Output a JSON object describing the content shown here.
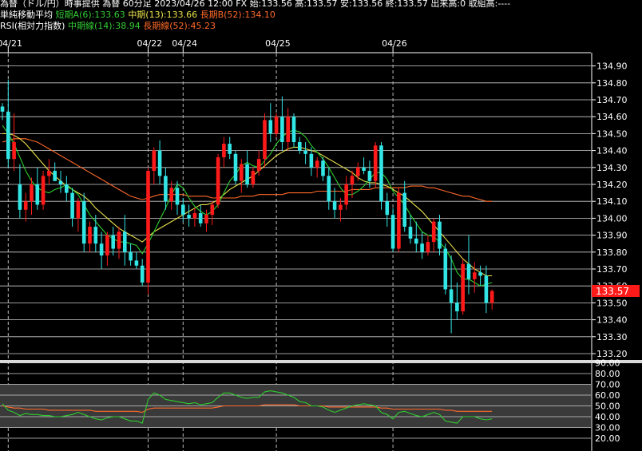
{
  "header": {
    "line1": "為替（ドル/円）時事提供 為替 60分足 2023/04/26 12:00 FX 始:133.56 高:133.57 安:133.56 終:133.57 出来高:0 取組高:----",
    "ma_title": "単純移動平均",
    "ma_short": "短期A(6):133.63",
    "ma_mid": "中期(13):133.66",
    "ma_long": "長期B(52):134.10",
    "rsi_title": "RSI(相対力指数)",
    "rsi_short": "中期線(14):38.94",
    "rsi_long": "長期線(52):45.23"
  },
  "colors": {
    "background": "#000000",
    "up": "#ff1a1a",
    "down": "#33e6e6",
    "ma_short": "#2ecc2e",
    "ma_mid": "#e8e04a",
    "ma_long": "#ff6a2a",
    "rsi_short": "#2ecc2e",
    "rsi_long": "#ff6a2a",
    "grid": "#ffffff",
    "badge": "#ff1a1a"
  },
  "chart_data": {
    "type": "candlestick",
    "dates": [
      {
        "label": "04/21",
        "index": 1
      },
      {
        "label": "04/22",
        "index": 25
      },
      {
        "label": "04/24",
        "index": 31
      },
      {
        "label": "04/25",
        "index": 47
      },
      {
        "label": "04/26",
        "index": 67
      }
    ],
    "ylim": [
      133.2,
      134.95
    ],
    "yticks": [
      "134.90",
      "134.80",
      "134.70",
      "134.60",
      "134.50",
      "134.40",
      "134.30",
      "134.20",
      "134.10",
      "134.00",
      "133.90",
      "133.80",
      "133.70",
      "133.60",
      "133.50",
      "133.40",
      "133.30",
      "133.20"
    ],
    "last_price": "133.57",
    "candles": [
      [
        134.66,
        134.68,
        134.58,
        134.63
      ],
      [
        134.63,
        134.82,
        134.3,
        134.35
      ],
      [
        134.35,
        134.62,
        134.28,
        134.45
      ],
      [
        134.2,
        134.32,
        134.0,
        134.05
      ],
      [
        134.05,
        134.15,
        133.98,
        134.1
      ],
      [
        134.1,
        134.24,
        134.02,
        134.2
      ],
      [
        134.2,
        134.3,
        134.05,
        134.08
      ],
      [
        134.08,
        134.28,
        134.05,
        134.25
      ],
      [
        134.25,
        134.35,
        134.2,
        134.28
      ],
      [
        134.28,
        134.33,
        134.22,
        134.22
      ],
      [
        134.22,
        134.28,
        134.15,
        134.2
      ],
      [
        134.2,
        134.25,
        134.1,
        134.15
      ],
      [
        134.15,
        134.18,
        133.95,
        134.0
      ],
      [
        134.0,
        134.12,
        133.92,
        134.1
      ],
      [
        134.1,
        134.15,
        133.8,
        133.85
      ],
      [
        133.85,
        133.98,
        133.8,
        133.95
      ],
      [
        133.95,
        134.02,
        133.8,
        133.85
      ],
      [
        133.85,
        133.92,
        133.7,
        133.78
      ],
      [
        133.78,
        133.92,
        133.72,
        133.9
      ],
      [
        133.9,
        133.95,
        133.78,
        133.82
      ],
      [
        133.82,
        133.95,
        133.76,
        133.92
      ],
      [
        133.92,
        134.02,
        133.72,
        133.8
      ],
      [
        133.8,
        133.85,
        133.72,
        133.75
      ],
      [
        133.75,
        133.8,
        133.7,
        133.72
      ],
      [
        133.72,
        133.76,
        133.6,
        133.62
      ],
      [
        133.62,
        134.3,
        133.55,
        134.28
      ],
      [
        134.28,
        134.42,
        134.2,
        134.4
      ],
      [
        134.4,
        134.46,
        134.2,
        134.25
      ],
      [
        134.25,
        134.3,
        134.05,
        134.1
      ],
      [
        134.1,
        134.22,
        134.05,
        134.18
      ],
      [
        134.18,
        134.22,
        134.02,
        134.08
      ],
      [
        134.08,
        134.12,
        133.98,
        134.02
      ],
      [
        134.02,
        134.08,
        133.95,
        134.0
      ],
      [
        134.0,
        134.06,
        133.95,
        134.03
      ],
      [
        134.03,
        134.08,
        133.95,
        133.97
      ],
      [
        133.97,
        134.05,
        133.92,
        134.02
      ],
      [
        134.02,
        134.1,
        133.96,
        134.08
      ],
      [
        134.08,
        134.38,
        134.06,
        134.36
      ],
      [
        134.36,
        134.48,
        134.3,
        134.44
      ],
      [
        134.44,
        134.48,
        134.35,
        134.38
      ],
      [
        134.38,
        134.4,
        134.2,
        134.22
      ],
      [
        134.22,
        134.35,
        134.15,
        134.32
      ],
      [
        134.32,
        134.4,
        134.18,
        134.2
      ],
      [
        134.2,
        134.3,
        134.18,
        134.28
      ],
      [
        134.28,
        134.4,
        134.25,
        134.35
      ],
      [
        134.35,
        134.62,
        134.3,
        134.58
      ],
      [
        134.58,
        134.68,
        134.45,
        134.5
      ],
      [
        134.5,
        134.62,
        134.48,
        134.6
      ],
      [
        134.6,
        134.72,
        134.4,
        134.45
      ],
      [
        134.45,
        134.65,
        134.4,
        134.6
      ],
      [
        134.6,
        134.62,
        134.42,
        134.45
      ],
      [
        134.45,
        134.48,
        134.38,
        134.4
      ],
      [
        134.4,
        134.45,
        134.32,
        134.38
      ],
      [
        134.38,
        134.42,
        134.25,
        134.3
      ],
      [
        134.3,
        134.36,
        134.24,
        134.34
      ],
      [
        134.34,
        134.36,
        134.22,
        134.25
      ],
      [
        134.25,
        134.3,
        134.05,
        134.1
      ],
      [
        134.1,
        134.18,
        134.0,
        134.05
      ],
      [
        134.05,
        134.12,
        133.98,
        134.08
      ],
      [
        134.08,
        134.25,
        134.05,
        134.2
      ],
      [
        134.2,
        134.28,
        134.12,
        134.25
      ],
      [
        134.25,
        134.33,
        134.22,
        134.3
      ],
      [
        134.3,
        134.36,
        134.26,
        134.28
      ],
      [
        134.28,
        134.34,
        134.18,
        134.22
      ],
      [
        134.22,
        134.45,
        134.18,
        134.43
      ],
      [
        134.43,
        134.45,
        134.05,
        134.1
      ],
      [
        134.1,
        134.15,
        133.95,
        134.02
      ],
      [
        134.02,
        134.06,
        133.8,
        133.82
      ],
      [
        133.82,
        134.18,
        133.8,
        134.15
      ],
      [
        134.15,
        134.22,
        133.92,
        133.95
      ],
      [
        133.95,
        134.02,
        133.85,
        133.88
      ],
      [
        133.88,
        133.98,
        133.8,
        133.85
      ],
      [
        133.85,
        133.92,
        133.76,
        133.8
      ],
      [
        133.8,
        133.9,
        133.78,
        133.86
      ],
      [
        133.86,
        134.0,
        133.8,
        133.98
      ],
      [
        133.98,
        134.02,
        133.78,
        133.82
      ],
      [
        133.82,
        133.85,
        133.55,
        133.58
      ],
      [
        133.58,
        133.78,
        133.32,
        133.5
      ],
      [
        133.5,
        133.62,
        133.4,
        133.45
      ],
      [
        133.45,
        133.76,
        133.43,
        133.73
      ],
      [
        133.73,
        133.9,
        133.55,
        133.64
      ],
      [
        133.64,
        133.74,
        133.56,
        133.68
      ],
      [
        133.68,
        133.72,
        133.6,
        133.66
      ],
      [
        133.66,
        133.72,
        133.44,
        133.5
      ],
      [
        133.5,
        133.58,
        133.46,
        133.57
      ]
    ],
    "ma_short_series": [
      134.55,
      134.5,
      134.44,
      134.36,
      134.28,
      134.22,
      134.18,
      134.16,
      134.15,
      134.17,
      134.18,
      134.2,
      134.17,
      134.14,
      134.08,
      134.02,
      133.98,
      133.94,
      133.9,
      133.88,
      133.86,
      133.86,
      133.85,
      133.84,
      133.79,
      133.85,
      133.92,
      133.99,
      134.06,
      134.14,
      134.2,
      134.18,
      134.12,
      134.07,
      134.04,
      134.02,
      134.04,
      134.08,
      134.15,
      134.22,
      134.26,
      134.31,
      134.33,
      134.31,
      134.3,
      134.34,
      134.38,
      134.44,
      134.48,
      134.51,
      134.52,
      134.51,
      134.48,
      134.43,
      134.39,
      134.35,
      134.3,
      134.24,
      134.18,
      134.14,
      134.14,
      134.16,
      134.19,
      134.23,
      134.27,
      134.27,
      134.23,
      134.16,
      134.12,
      134.08,
      134.02,
      133.97,
      133.92,
      133.9,
      133.89,
      133.86,
      133.82,
      133.76,
      133.68,
      133.64,
      133.64,
      133.62,
      133.6,
      133.61,
      133.62
    ],
    "ma_mid_series": [
      134.5,
      134.5,
      134.49,
      134.47,
      134.44,
      134.4,
      134.36,
      134.32,
      134.28,
      134.25,
      134.22,
      134.19,
      134.17,
      134.15,
      134.13,
      134.1,
      134.06,
      134.03,
      134.0,
      133.97,
      133.94,
      133.92,
      133.9,
      133.88,
      133.86,
      133.89,
      133.92,
      133.94,
      133.96,
      133.98,
      134.0,
      134.02,
      134.04,
      134.06,
      134.08,
      134.08,
      134.09,
      134.11,
      134.14,
      134.17,
      134.19,
      134.21,
      134.23,
      134.25,
      134.28,
      134.31,
      134.34,
      134.37,
      134.39,
      134.41,
      134.42,
      134.42,
      134.41,
      134.4,
      134.39,
      134.37,
      134.35,
      134.33,
      134.31,
      134.29,
      134.27,
      134.24,
      134.22,
      134.21,
      134.21,
      134.2,
      134.19,
      134.17,
      134.15,
      134.13,
      134.1,
      134.07,
      134.04,
      134.0,
      133.96,
      133.92,
      133.88,
      133.84,
      133.8,
      133.76,
      133.73,
      133.7,
      133.68,
      133.66,
      133.66
    ],
    "ma_long_series": [
      134.45,
      134.46,
      134.47,
      134.47,
      134.47,
      134.46,
      134.45,
      134.43,
      134.41,
      134.39,
      134.37,
      134.35,
      134.33,
      134.31,
      134.29,
      134.27,
      134.25,
      134.23,
      134.21,
      134.19,
      134.17,
      134.15,
      134.13,
      134.12,
      134.11,
      134.12,
      134.13,
      134.14,
      134.14,
      134.14,
      134.14,
      134.14,
      134.13,
      134.13,
      134.13,
      134.13,
      134.12,
      134.12,
      134.12,
      134.12,
      134.12,
      134.13,
      134.13,
      134.13,
      134.14,
      134.14,
      134.14,
      134.14,
      134.14,
      134.15,
      134.15,
      134.15,
      134.15,
      134.15,
      134.16,
      134.16,
      134.16,
      134.16,
      134.16,
      134.16,
      134.17,
      134.17,
      134.17,
      134.17,
      134.18,
      134.18,
      134.18,
      134.18,
      134.18,
      134.18,
      134.19,
      134.19,
      134.19,
      134.18,
      134.18,
      134.17,
      134.16,
      134.15,
      134.14,
      134.13,
      134.13,
      134.12,
      134.11,
      134.1,
      134.1
    ],
    "rsi": {
      "ylim": [
        20,
        90
      ],
      "yticks": [
        "90.00",
        "80.00",
        "70.00",
        "60.00",
        "50.00",
        "40.00",
        "30.00",
        "20.00"
      ],
      "short_series": [
        52,
        46,
        44,
        41,
        43,
        42,
        42,
        41,
        41,
        40,
        40,
        41,
        42,
        44,
        42,
        40,
        38,
        37,
        39,
        40,
        40,
        38,
        36,
        36,
        34,
        56,
        62,
        60,
        56,
        55,
        54,
        53,
        52,
        53,
        51,
        52,
        53,
        58,
        62,
        62,
        60,
        58,
        57,
        58,
        58,
        63,
        64,
        63,
        62,
        60,
        58,
        54,
        53,
        50,
        50,
        49,
        46,
        44,
        46,
        48,
        50,
        51,
        52,
        51,
        50,
        44,
        42,
        38,
        44,
        45,
        43,
        41,
        40,
        42,
        44,
        42,
        36,
        35,
        34,
        40,
        40,
        40,
        38,
        37,
        38
      ],
      "long_series": [
        50,
        49,
        48,
        48,
        47,
        47,
        47,
        47,
        46,
        46,
        46,
        46,
        46,
        46,
        46,
        46,
        45,
        45,
        45,
        45,
        45,
        45,
        45,
        45,
        44,
        47,
        48,
        48,
        48,
        48,
        48,
        48,
        48,
        48,
        48,
        48,
        48,
        49,
        50,
        50,
        50,
        50,
        50,
        50,
        50,
        51,
        51,
        51,
        51,
        51,
        51,
        50,
        50,
        50,
        50,
        50,
        49,
        49,
        49,
        49,
        49,
        49,
        49,
        49,
        49,
        48,
        48,
        47,
        47,
        47,
        47,
        47,
        47,
        47,
        47,
        47,
        46,
        46,
        45,
        45,
        45,
        45,
        45,
        45,
        45
      ]
    }
  }
}
